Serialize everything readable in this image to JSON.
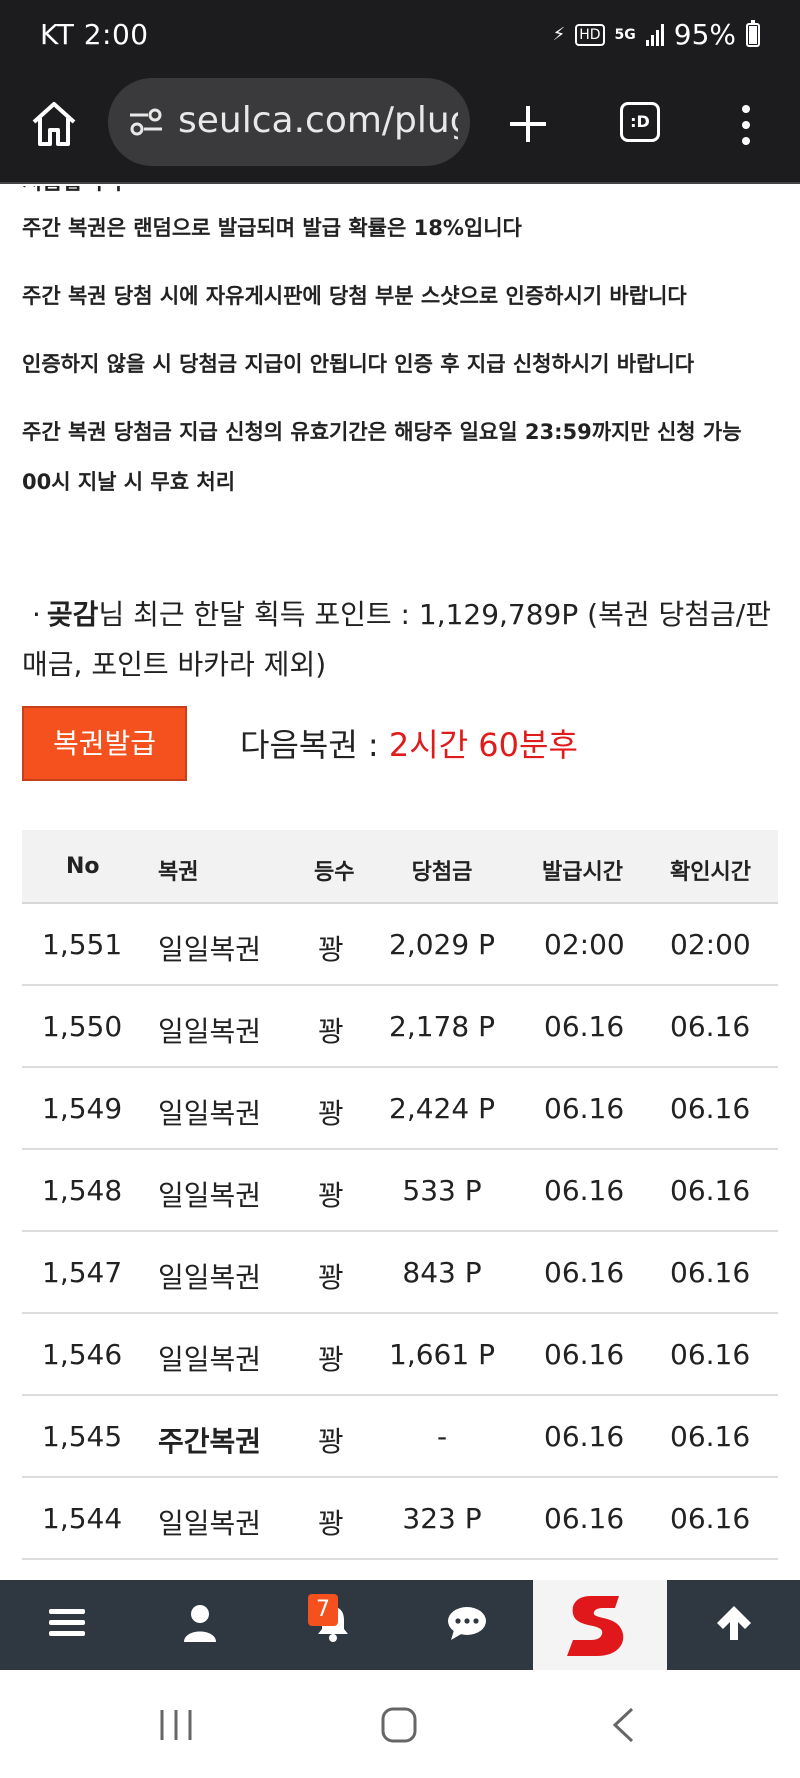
{
  "status_bar": {
    "carrier_time": "KT 2:00",
    "battery": "95%",
    "icons": [
      "battery-saver-icon",
      "hd-icon",
      "5g-icon",
      "signal-icon",
      "battery-icon"
    ]
  },
  "browser": {
    "url": "seulca.com/plug",
    "tabs_label": ":D"
  },
  "notices": {
    "clipped": "지급합니다",
    "lines": [
      "주간 복권은 랜덤으로 발급되며 발급 확률은 18%입니다",
      "주간 복권 당첨 시에 자유게시판에 당첨 부분 스샷으로 인증하시기 바랍니다",
      "인증하지 않을 시 당첨금 지급이 안됩니다 인증 후 지급 신청하시기 바랍니다",
      "주간 복권 당첨금 지급 신청의 유효기간은 해당주 일요일 23:59까지만 신청 가능",
      "00시 지날 시 무효 처리"
    ]
  },
  "points": {
    "bullet": "·",
    "nickname": "곶감",
    "text": "님 최근 한달 획득 포인트 : 1,129,789P (복권 당첨금/판매금, 포인트 바카라 제외)"
  },
  "lottery": {
    "issue_button": "복권발급",
    "next_label": "다음복권 : ",
    "next_value": "2시간 60분후"
  },
  "table": {
    "headers": {
      "no": "No",
      "kind": "복권",
      "rank": "등수",
      "prize": "당첨금",
      "issued": "발급시간",
      "checked": "확인시간"
    },
    "rows": [
      {
        "no": "1,551",
        "kind": "일일복권",
        "rank": "꽝",
        "prize": "2,029 P",
        "issued": "02:00",
        "checked": "02:00",
        "weekly": false
      },
      {
        "no": "1,550",
        "kind": "일일복권",
        "rank": "꽝",
        "prize": "2,178 P",
        "issued": "06.16",
        "checked": "06.16",
        "weekly": false
      },
      {
        "no": "1,549",
        "kind": "일일복권",
        "rank": "꽝",
        "prize": "2,424 P",
        "issued": "06.16",
        "checked": "06.16",
        "weekly": false
      },
      {
        "no": "1,548",
        "kind": "일일복권",
        "rank": "꽝",
        "prize": "533 P",
        "issued": "06.16",
        "checked": "06.16",
        "weekly": false
      },
      {
        "no": "1,547",
        "kind": "일일복권",
        "rank": "꽝",
        "prize": "843 P",
        "issued": "06.16",
        "checked": "06.16",
        "weekly": false
      },
      {
        "no": "1,546",
        "kind": "일일복권",
        "rank": "꽝",
        "prize": "1,661 P",
        "issued": "06.16",
        "checked": "06.16",
        "weekly": false
      },
      {
        "no": "1,545",
        "kind": "주간복권",
        "rank": "꽝",
        "prize": "-",
        "issued": "06.16",
        "checked": "06.16",
        "weekly": true
      },
      {
        "no": "1,544",
        "kind": "일일복권",
        "rank": "꽝",
        "prize": "323 P",
        "issued": "06.16",
        "checked": "06.16",
        "weekly": false
      }
    ]
  },
  "site_nav": {
    "items": [
      "menu-icon",
      "user-icon",
      "bell-icon",
      "chat-icon",
      "site-logo",
      "arrow-up-icon"
    ],
    "notification_count": "7"
  },
  "colors": {
    "accent": "#f4511e",
    "next_value": "#e01b1b",
    "nav_bg": "#2f3741",
    "status_bg": "#1c1c1e"
  }
}
